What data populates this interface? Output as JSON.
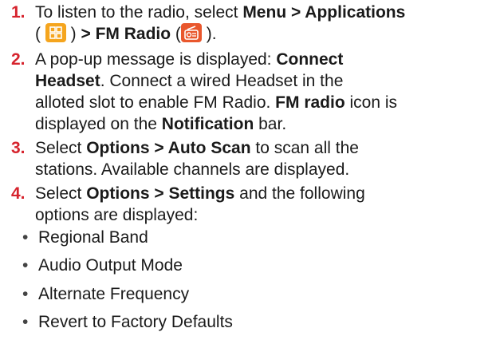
{
  "steps": [
    {
      "number": "1.",
      "l1_a": "To listen to the radio, select ",
      "l1_b": "Menu > Applications",
      "l2_a": "( ",
      "l2_b": " ) ",
      "l2_c": "> FM Radio",
      "l2_d": " (",
      "l2_e": " )."
    },
    {
      "number": "2.",
      "l1_a": "A pop-up message is displayed: ",
      "l1_b": "Connect",
      "l2_a": "Headset",
      "l2_b": ". Connect a wired Headset in the",
      "l3_a": "alloted slot to enable FM Radio. ",
      "l3_b": "FM radio",
      "l3_c": " icon is",
      "l4_a": "displayed on the ",
      "l4_b": "Notification",
      "l4_c": " bar."
    },
    {
      "number": "3.",
      "l1_a": "Select ",
      "l1_b": "Options > Auto Scan",
      "l1_c": " to scan all the",
      "l2_a": "stations. Available channels are displayed."
    },
    {
      "number": "4.",
      "l1_a": "Select ",
      "l1_b": "Options > Settings",
      "l1_c": " and the following",
      "l2_a": "options are displayed:"
    }
  ],
  "bullets": [
    "Regional Band",
    "Audio Output Mode",
    "Alternate Frequency",
    "Revert to Factory Defaults"
  ],
  "bullet_symbol": "•",
  "icons": {
    "applications": "apps-grid-icon",
    "fm_radio": "fm-radio-icon"
  },
  "colors": {
    "step_number": "#d6232d",
    "applications_icon": "#f5a51e",
    "fm_radio_icon": "#e9572d"
  }
}
